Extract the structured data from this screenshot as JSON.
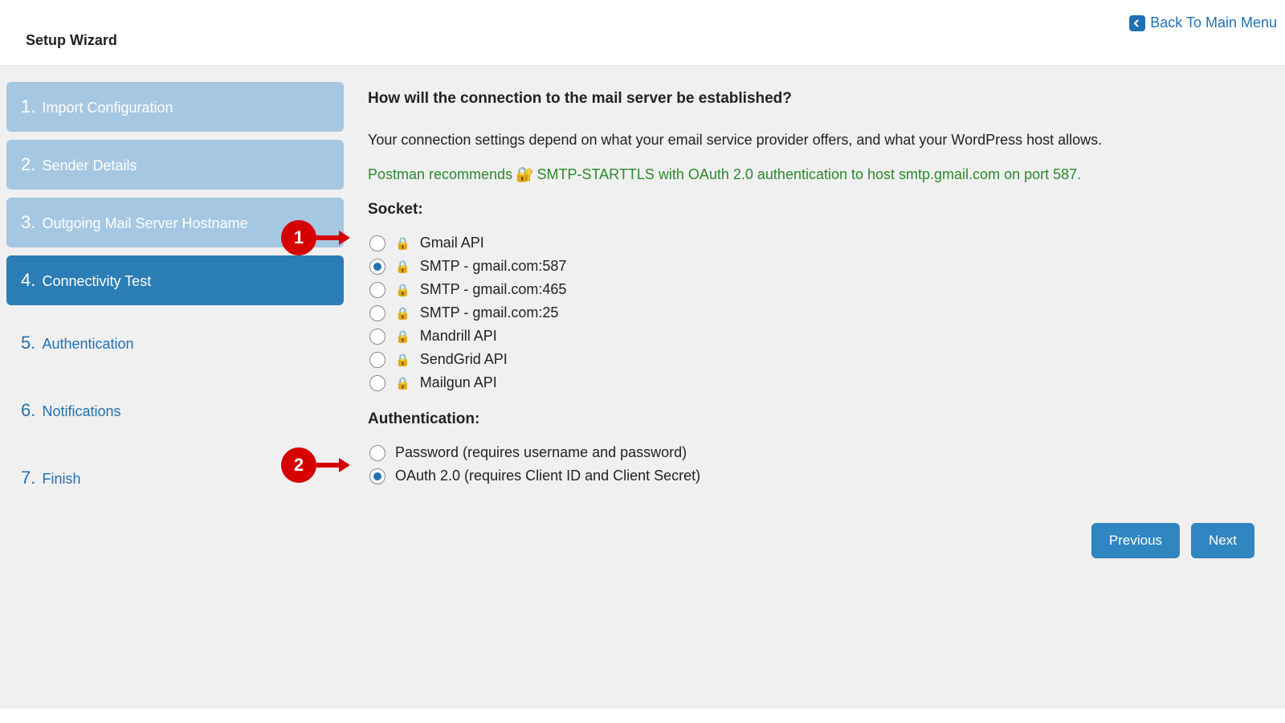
{
  "header": {
    "title": "Setup Wizard",
    "back_label": "Back To Main Menu"
  },
  "steps": [
    {
      "num": "1.",
      "label": "Import Configuration",
      "state": "done"
    },
    {
      "num": "2.",
      "label": "Sender Details",
      "state": "done"
    },
    {
      "num": "3.",
      "label": "Outgoing Mail Server Hostname",
      "state": "done"
    },
    {
      "num": "4.",
      "label": "Connectivity Test",
      "state": "active"
    },
    {
      "num": "5.",
      "label": "Authentication",
      "state": "future"
    },
    {
      "num": "6.",
      "label": "Notifications",
      "state": "future"
    },
    {
      "num": "7.",
      "label": "Finish",
      "state": "future"
    }
  ],
  "main": {
    "heading": "How will the connection to the mail server be established?",
    "description": "Your connection settings depend on what your email service provider offers, and what your WordPress host allows.",
    "recommend_prefix": "Postman recommends",
    "recommend_text": "SMTP-STARTTLS with OAuth 2.0 authentication to host smtp.gmail.com on port 587.",
    "socket_label": "Socket:",
    "socket_options": [
      {
        "label": "Gmail API",
        "checked": false,
        "lock": true
      },
      {
        "label": "SMTP - gmail.com:587",
        "checked": true,
        "lock": true
      },
      {
        "label": "SMTP - gmail.com:465",
        "checked": false,
        "lock": true
      },
      {
        "label": "SMTP - gmail.com:25",
        "checked": false,
        "lock": true
      },
      {
        "label": "Mandrill API",
        "checked": false,
        "lock": true
      },
      {
        "label": "SendGrid API",
        "checked": false,
        "lock": true
      },
      {
        "label": "Mailgun API",
        "checked": false,
        "lock": true
      }
    ],
    "auth_label": "Authentication:",
    "auth_options": [
      {
        "label": "Password (requires username and password)",
        "checked": false
      },
      {
        "label": "OAuth 2.0 (requires Client ID and Client Secret)",
        "checked": true
      }
    ]
  },
  "callouts": {
    "c1": "1",
    "c2": "2"
  },
  "buttons": {
    "prev": "Previous",
    "next": "Next"
  }
}
